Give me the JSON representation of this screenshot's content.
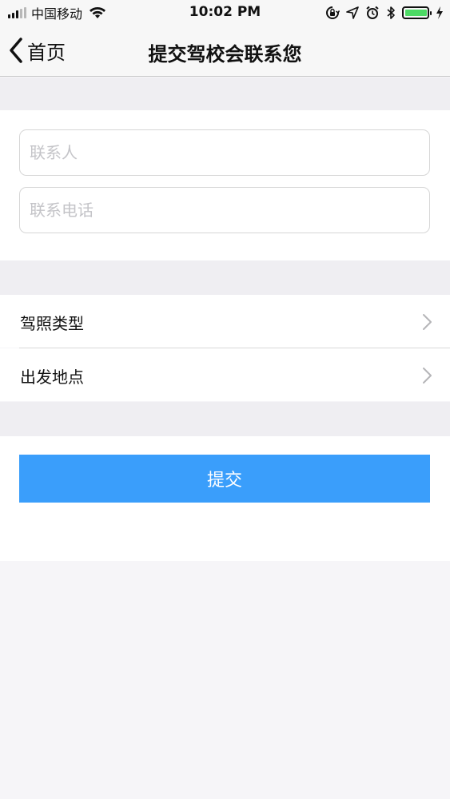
{
  "status_bar": {
    "carrier": "中国移动",
    "time": "10:02 PM",
    "battery_level": 0.9,
    "battery_color": "#4cd964"
  },
  "nav": {
    "back_label": "首页",
    "title": "提交驾校会联系您"
  },
  "form": {
    "contact_placeholder": "联系人",
    "contact_value": "",
    "phone_placeholder": "联系电话",
    "phone_value": ""
  },
  "options": {
    "license_type_label": "驾照类型",
    "departure_label": "出发地点"
  },
  "submit": {
    "label": "提交",
    "color": "#3a9efb"
  },
  "icons": {
    "back": "chevron-left-icon",
    "row_arrow": "chevron-right-icon",
    "wifi": "wifi-icon",
    "orientation_lock": "orientation-lock-icon",
    "location": "location-arrow-icon",
    "alarm": "alarm-icon",
    "bluetooth": "bluetooth-icon",
    "charging": "charging-bolt-icon"
  }
}
